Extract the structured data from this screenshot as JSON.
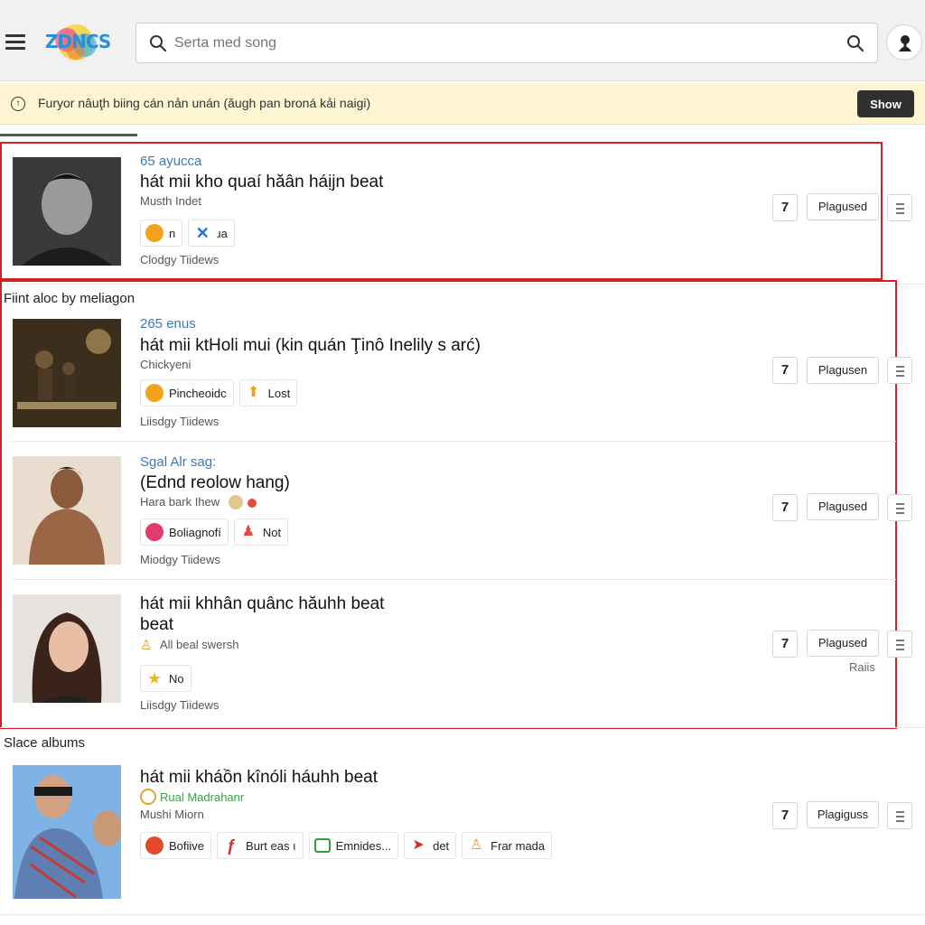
{
  "header": {
    "logo_text": "ZDNCS",
    "search_placeholder": "Serta med song"
  },
  "banner": {
    "icon_glyph": "↑",
    "text": "Furyor nâuţh biing cán nản unán (ăugh pan broná kải naigi)",
    "button_label": "Show"
  },
  "sections": {
    "mid_title": "Fiint aloc by meliagon",
    "bottom_title": "Slace albums"
  },
  "rows": [
    {
      "stat": "65 ayucca",
      "title": "hát mii kho quaí hăân háịjn beat",
      "subtitle": "Musth Indet",
      "chips": [
        {
          "label": "n",
          "icon": "crown-icon",
          "color": "#f2a31b"
        },
        {
          "label": "ɹa",
          "icon": "x-icon",
          "color": "#2a6fd6"
        }
      ],
      "meta": "Clodgy Tiidews",
      "num": "7",
      "tag": "Plagused"
    },
    {
      "stat": "265 enus",
      "title": "hát mii ktHoli mui (kin quán Ţinô Inelily s arć)",
      "subtitle": "Chickyeni",
      "chips": [
        {
          "label": "Pincheoidc",
          "icon": "phone-icon",
          "color": "#f2a31b"
        },
        {
          "label": "Lost",
          "icon": "user-icon",
          "color": "#f29a1b"
        }
      ],
      "meta": "Liisdgy Tiidews",
      "num": "7",
      "tag": "Plagusen"
    },
    {
      "stat": "Sgal Alr sag:",
      "title": "(Ednd reolow hang)",
      "subtitle": "Hara bark Ihew",
      "chips": [
        {
          "label": "Boliagnofí",
          "icon": "badge-icon",
          "color": "#e23b6d"
        },
        {
          "label": "Not",
          "icon": "figure-icon",
          "color": "#e24a3b"
        }
      ],
      "meta": "Miodgy Tiidews",
      "num": "7",
      "tag": "Plagused"
    },
    {
      "stat": "",
      "title": "hát mii khhân quânc hăuhh beat beat",
      "subtitle": "All beal swersh",
      "chips": [
        {
          "label": "No",
          "icon": "star-icon",
          "color": "#f2b41b"
        }
      ],
      "meta": "Liisdgy Tiidews",
      "num": "7",
      "tag": "Plagused",
      "extra": "Raiis"
    },
    {
      "stat": "",
      "title": "hát mii kháồn kînóli háuhh beat",
      "subtitle_accent": "Rual Madrahanr",
      "subtitle": "Mushi Miorn",
      "chips": [
        {
          "label": "Bofiive",
          "icon": "record-icon",
          "color": "#e24a2b"
        },
        {
          "label": "Burt eas ı",
          "icon": "fork-icon",
          "color": "#d62b2b"
        },
        {
          "label": "Emnides...",
          "icon": "chat-icon",
          "color": "#2e9e3e"
        },
        {
          "label": "det",
          "icon": "arrow-icon",
          "color": "#d62b2b"
        },
        {
          "label": "Frar mada",
          "icon": "person-icon",
          "color": "#f29a1b"
        }
      ],
      "meta": "",
      "num": "7",
      "tag": "Plagiguss"
    }
  ],
  "colors": {
    "highlight": "#d32027",
    "accent_blue": "#3b7ab8",
    "banner_bg": "#fdf4d2"
  }
}
